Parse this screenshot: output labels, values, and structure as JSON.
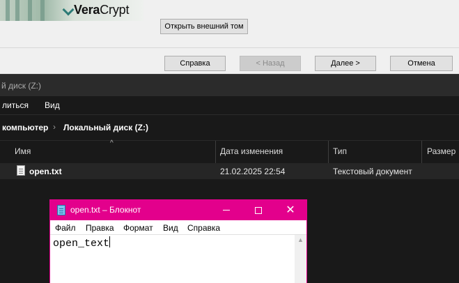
{
  "veracrypt": {
    "logo_bold": "Vera",
    "logo_rest": "Crypt",
    "outer_volume_button": "Открыть внешний том",
    "help_button": "Справка",
    "back_button": "< Назад",
    "next_button": "Далее >",
    "cancel_button": "Отмена"
  },
  "explorer": {
    "title": "й диск (Z:)",
    "menu": {
      "share": "литься",
      "view": "Вид"
    },
    "breadcrumb": {
      "computer": "компьютер",
      "drive": "Локальный диск (Z:)"
    },
    "columns": {
      "name": "Имя",
      "date": "Дата изменения",
      "type": "Тип",
      "size": "Размер"
    },
    "files": [
      {
        "name": "open.txt",
        "date": "21.02.2025 22:54",
        "type": "Текстовый документ",
        "icon": "text-file-icon"
      }
    ]
  },
  "notepad": {
    "title": "open.txt – Блокнот",
    "menu": {
      "file": "Файл",
      "edit": "Правка",
      "format": "Формат",
      "view": "Вид",
      "help": "Справка"
    },
    "content": "open_text",
    "accent_color": "#e3008c"
  }
}
